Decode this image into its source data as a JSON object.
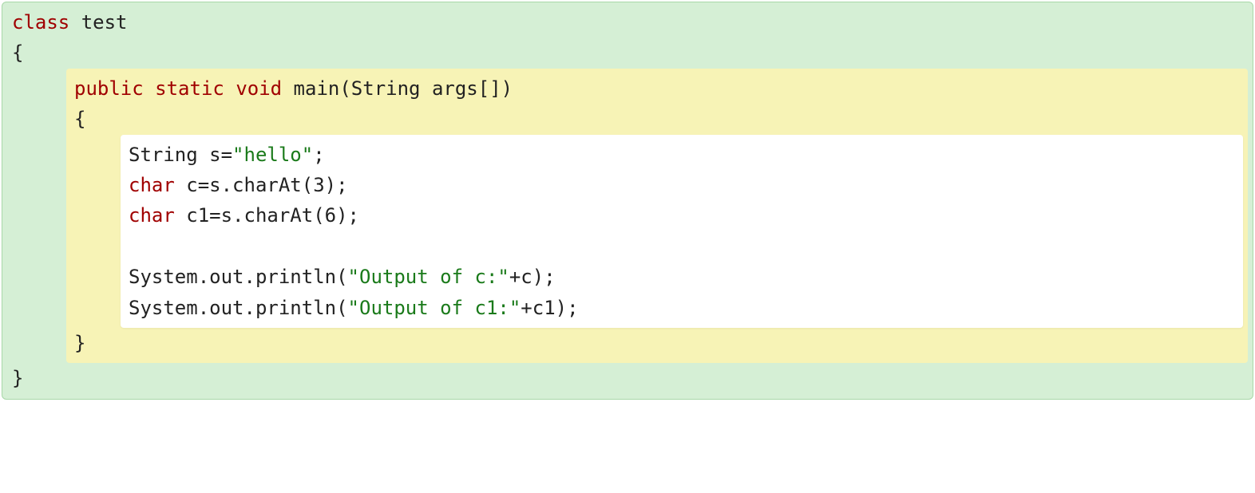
{
  "code": {
    "kw_class": "class",
    "class_name": " test",
    "brace_open": "{",
    "brace_close": "}",
    "method": {
      "kw_public": "public",
      "sp1": " ",
      "kw_static": "static",
      "sp2": " ",
      "kw_void": "void",
      "sig_rest": " main(String args[])",
      "brace_open": "{",
      "brace_close": "}",
      "body": {
        "l1_a": "String s=",
        "l1_str": "\"hello\"",
        "l1_b": ";",
        "l2_kw": "char",
        "l2_rest": " c=s.charAt(3);",
        "l3_kw": "char",
        "l3_rest": " c1=s.charAt(6);",
        "blank": " ",
        "l4_a": "System.out.println(",
        "l4_str": "\"Output of c:\"",
        "l4_b": "+c);",
        "l5_a": "System.out.println(",
        "l5_str": "\"Output of c1:\"",
        "l5_b": "+c1);"
      }
    }
  }
}
